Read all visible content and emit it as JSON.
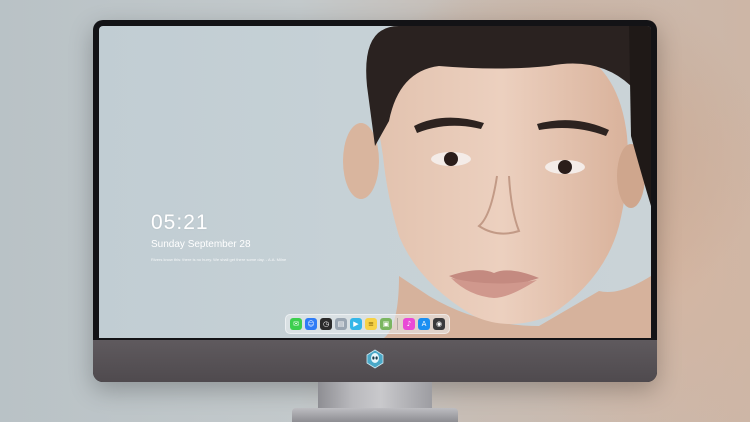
{
  "lockscreen": {
    "time": "05:21",
    "date": "Sunday September  28",
    "quote": "Rivers know this: there is no hurry. We shall get there some day.  - A.A. Milne"
  },
  "dock": {
    "items": [
      {
        "name": "messages-icon",
        "color": "#3ccf4e",
        "glyph": "✉"
      },
      {
        "name": "finder-icon",
        "color": "#2f7cf6",
        "glyph": "☺"
      },
      {
        "name": "clock-icon",
        "color": "#2b2b2b",
        "glyph": "◷"
      },
      {
        "name": "preview-icon",
        "color": "#9aa6b2",
        "glyph": "▤"
      },
      {
        "name": "clapperboard-icon",
        "color": "#34b6e8",
        "glyph": "▶"
      },
      {
        "name": "notes-icon",
        "color": "#f6d246",
        "glyph": "≡"
      },
      {
        "name": "photos-icon",
        "color": "#7bb661",
        "glyph": "▣"
      },
      {
        "name": "music-icon",
        "color": "#e94ad6",
        "glyph": "♪"
      },
      {
        "name": "app-store-icon",
        "color": "#1b8ff2",
        "glyph": "A"
      },
      {
        "name": "camera-icon",
        "color": "#3a3a3c",
        "glyph": "◉"
      }
    ]
  },
  "colors": {
    "bezel": "#131316",
    "chin": "#575256",
    "wallpaper": "#c6d1d6"
  }
}
